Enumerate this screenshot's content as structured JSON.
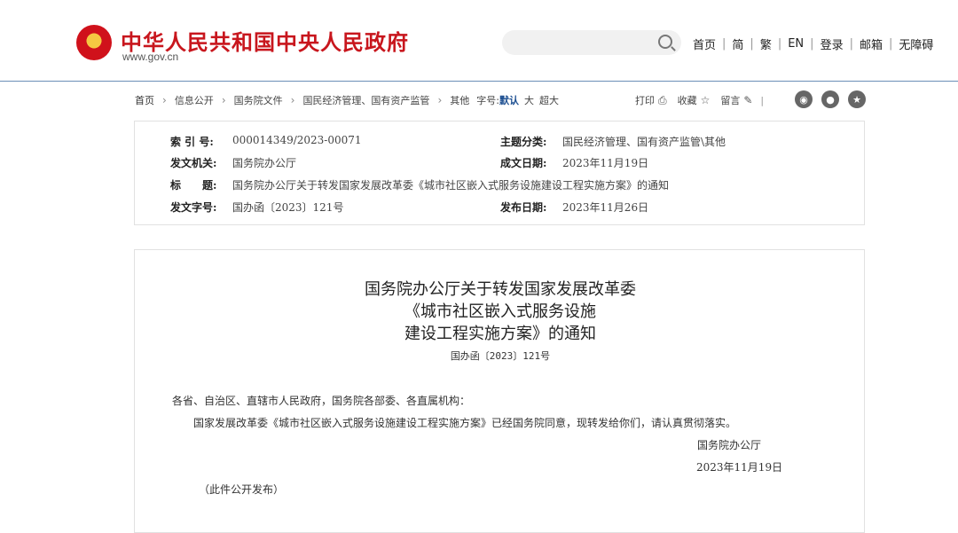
{
  "header": {
    "site_title": "中华人民共和国中央人民政府",
    "site_url": "www.gov.cn",
    "search_placeholder": "",
    "links": [
      "首页",
      "简",
      "繁",
      "EN",
      "登录",
      "邮箱",
      "无障碍"
    ]
  },
  "breadcrumb": {
    "items": [
      "首页",
      "信息公开",
      "国务院文件",
      "国民经济管理、国有资产监管",
      "其他"
    ],
    "font_label": "字号:",
    "font_sizes": [
      "默认",
      "大",
      "超大"
    ]
  },
  "tools": {
    "print": "打印",
    "favorite": "收藏",
    "comment": "留言"
  },
  "social_icons": [
    "weibo-icon",
    "wechat-icon",
    "star-icon"
  ],
  "meta": {
    "index_label": "索 引 号:",
    "index_value": "000014349/2023-00071",
    "topic_label": "主题分类:",
    "topic_value": "国民经济管理、国有资产监管\\其他",
    "issuer_label": "发文机关:",
    "issuer_value": "国务院办公厅",
    "created_label": "成文日期:",
    "created_value": "2023年11月19日",
    "title_label": "标　　题:",
    "title_value": "国务院办公厅关于转发国家发展改革委《城市社区嵌入式服务设施建设工程实施方案》的通知",
    "docno_label": "发文字号:",
    "docno_value": "国办函〔2023〕121号",
    "published_label": "发布日期:",
    "published_value": "2023年11月26日"
  },
  "article": {
    "title_lines": [
      "国务院办公厅关于转发国家发展改革委",
      "《城市社区嵌入式服务设施",
      "建设工程实施方案》的通知"
    ],
    "doc_number": "国办函〔2023〕121号",
    "salutation": "各省、自治区、直辖市人民政府，国务院各部委、各直属机构：",
    "paragraph": "国家发展改革委《城市社区嵌入式服务设施建设工程实施方案》已经国务院同意，现转发给你们，请认真贯彻落实。",
    "signature": "国务院办公厅",
    "date": "2023年11月19日",
    "note": "（此件公开发布）"
  },
  "colors": {
    "brand_red": "#c8161d",
    "rule_blue": "#6a8fb7",
    "accent_blue": "#1d4f91"
  }
}
